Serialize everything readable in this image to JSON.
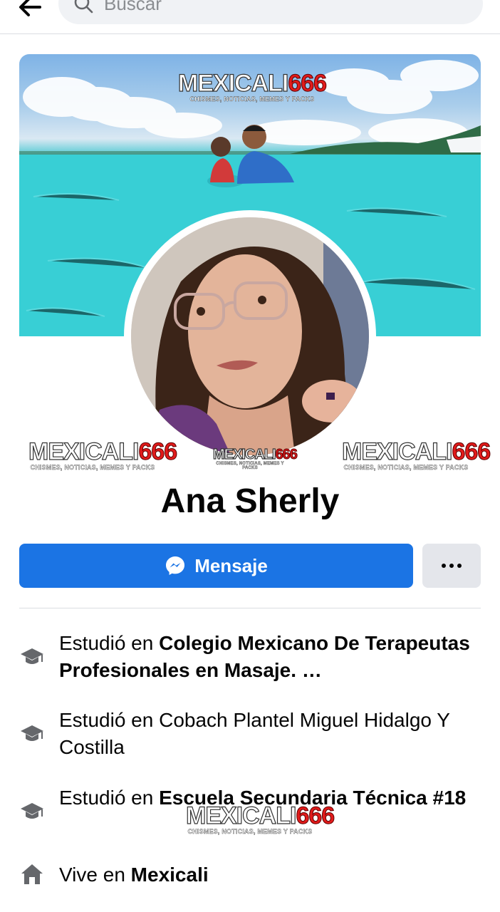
{
  "search": {
    "placeholder": "Buscar"
  },
  "profile": {
    "name": "Ana Sherly"
  },
  "actions": {
    "message_label": "Mensaje",
    "more_label": "•••"
  },
  "watermark": {
    "brand_white": "MEXICALI",
    "brand_red": "666",
    "tagline": "CHISMES, NOTICIAS, MEMES Y PACKS"
  },
  "details": [
    {
      "prefix": "Estudió en ",
      "place": "Colegio Mexicano De Terapeutas Profesionales en Masaje.",
      "suffix": " …",
      "icon": "graduation-cap-icon"
    },
    {
      "prefix": "Estudió en Cobach Plantel Miguel Hidalgo Y Costilla",
      "place": "",
      "suffix": "",
      "icon": "graduation-cap-icon"
    },
    {
      "prefix": "Estudió en ",
      "place": "Escuela Secundaria Técnica #18",
      "suffix": "",
      "icon": "graduation-cap-icon"
    },
    {
      "prefix": "Vive en ",
      "place": "Mexicali",
      "suffix": "",
      "icon": "home-icon"
    }
  ],
  "colors": {
    "accent": "#1b74e4",
    "icon_gray": "#65676b"
  }
}
